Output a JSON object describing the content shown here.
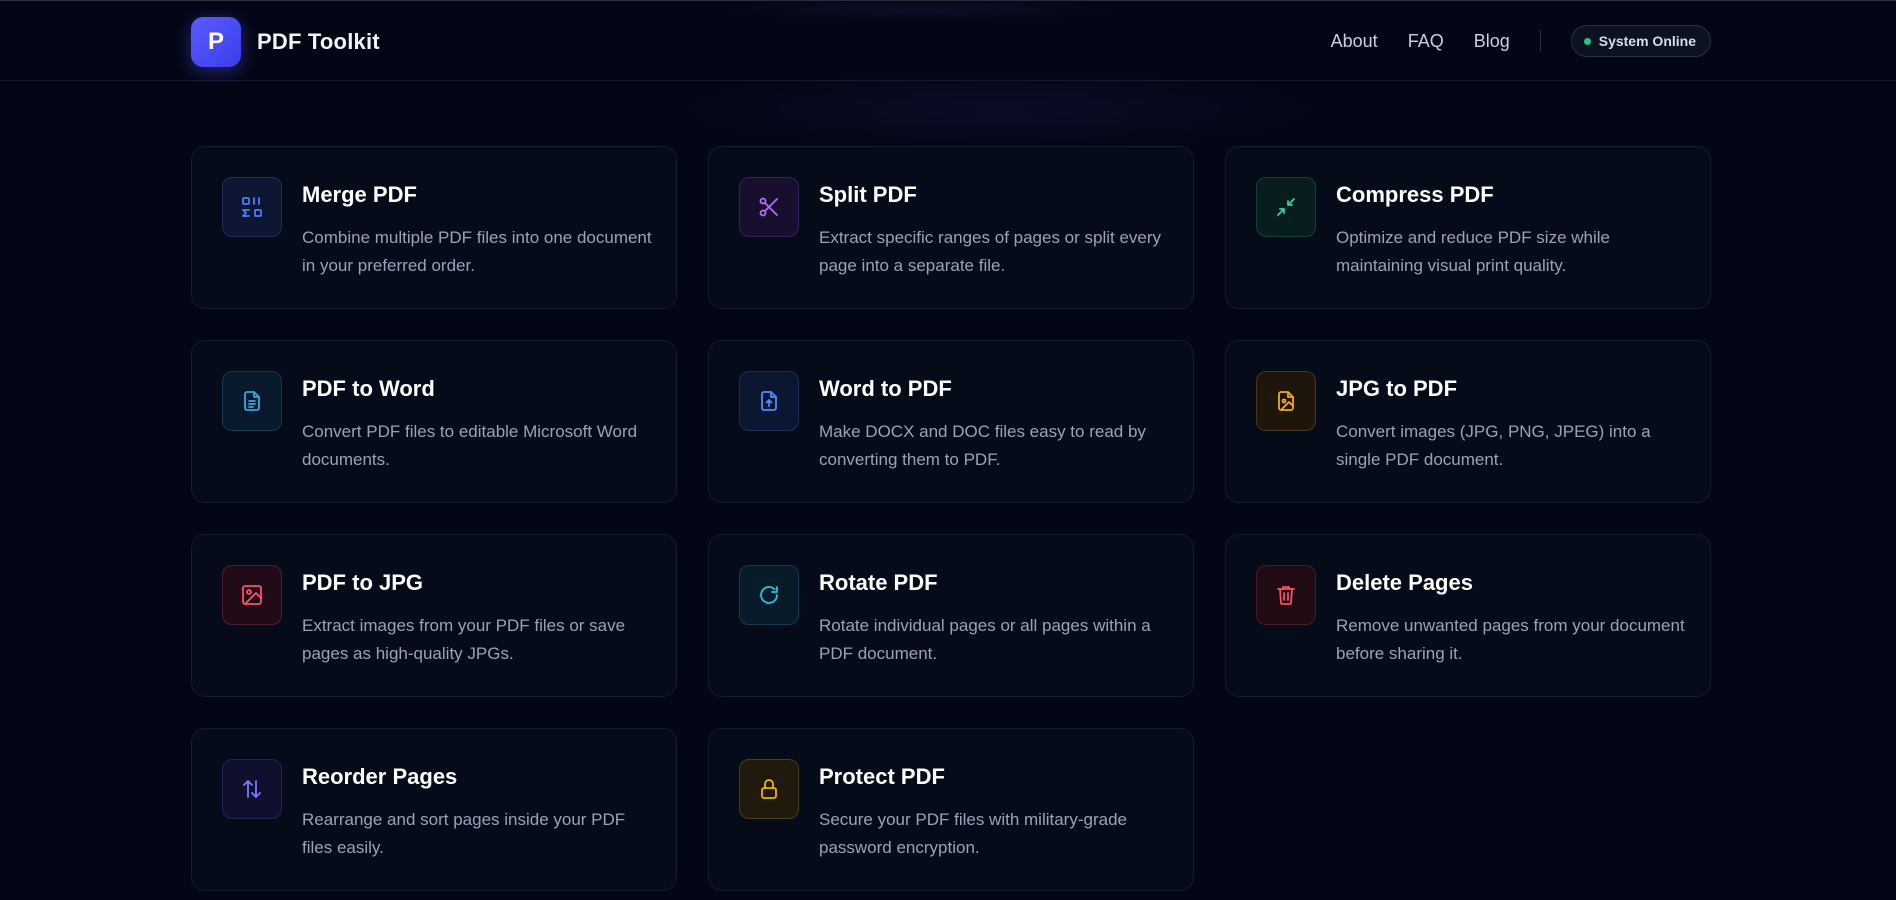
{
  "header": {
    "logo_letter": "P",
    "brand_name": "PDF Toolkit",
    "nav": {
      "about": "About",
      "faq": "FAQ",
      "blog": "Blog"
    },
    "status_label": "System Online"
  },
  "tools": [
    {
      "title": "Merge PDF",
      "description": "Combine multiple PDF files into one document in your preferred order.",
      "icon": "merge-icon",
      "color": "#4f7cff"
    },
    {
      "title": "Split PDF",
      "description": "Extract specific ranges of pages or split every page into a separate file.",
      "icon": "scissors-icon",
      "color": "#b06cff"
    },
    {
      "title": "Compress PDF",
      "description": "Optimize and reduce PDF size while maintaining visual print quality.",
      "icon": "compress-arrows-icon",
      "color": "#2ed3a0"
    },
    {
      "title": "PDF to Word",
      "description": "Convert PDF files to editable Microsoft Word documents.",
      "icon": "document-text-icon",
      "color": "#2ea9e6"
    },
    {
      "title": "Word to PDF",
      "description": "Make DOCX and DOC files easy to read by converting them to PDF.",
      "icon": "file-upload-icon",
      "color": "#4f8cff"
    },
    {
      "title": "JPG to PDF",
      "description": "Convert images (JPG, PNG, JPEG) into a single PDF document.",
      "icon": "image-file-icon",
      "color": "#f5a623"
    },
    {
      "title": "PDF to JPG",
      "description": "Extract images from your PDF files or save pages as high-quality JPGs.",
      "icon": "image-icon",
      "color": "#ff4d6d"
    },
    {
      "title": "Rotate PDF",
      "description": "Rotate individual pages or all pages within a PDF document.",
      "icon": "rotate-icon",
      "color": "#22c3e6"
    },
    {
      "title": "Delete Pages",
      "description": "Remove unwanted pages from your document before sharing it.",
      "icon": "trash-icon",
      "color": "#ff4d5e"
    },
    {
      "title": "Reorder Pages",
      "description": "Rearrange and sort pages inside your PDF files easily.",
      "icon": "sort-arrows-icon",
      "color": "#7b7bff"
    },
    {
      "title": "Protect PDF",
      "description": "Secure your PDF files with military-grade password encryption.",
      "icon": "lock-icon",
      "color": "#f5b400"
    }
  ]
}
